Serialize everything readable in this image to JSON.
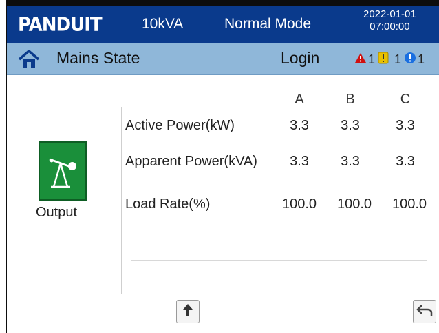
{
  "header": {
    "brand": "PANDUIT",
    "rating": "10kVA",
    "mode": "Normal Mode",
    "date": "2022-01-01",
    "time": "07:00:00"
  },
  "subheader": {
    "title": "Mains State",
    "login_label": "Login",
    "alarms": {
      "critical_count": "1",
      "warning_count": "1",
      "info_count": "1"
    }
  },
  "output": {
    "label": "Output",
    "icon": "switch-icon"
  },
  "table": {
    "columns": [
      "A",
      "B",
      "C"
    ],
    "rows": [
      {
        "label": "Active Power(kW)",
        "values": [
          "3.3",
          "3.3",
          "3.3"
        ]
      },
      {
        "label": "Apparent Power(kVA)",
        "values": [
          "3.3",
          "3.3",
          "3.3"
        ]
      },
      {
        "label": "Load Rate(%)",
        "values": [
          "100.0",
          "100.0",
          "100.0"
        ]
      }
    ]
  },
  "colors": {
    "header_bg": "#0a3a8c",
    "subheader_bg": "#8fb7d9",
    "output_green": "#1a8f3a",
    "critical": "#d01010",
    "warning": "#e8c000",
    "info": "#1a6fe0"
  },
  "icons": {
    "home": "home-icon",
    "up": "arrow-up-icon",
    "back": "back-icon"
  }
}
